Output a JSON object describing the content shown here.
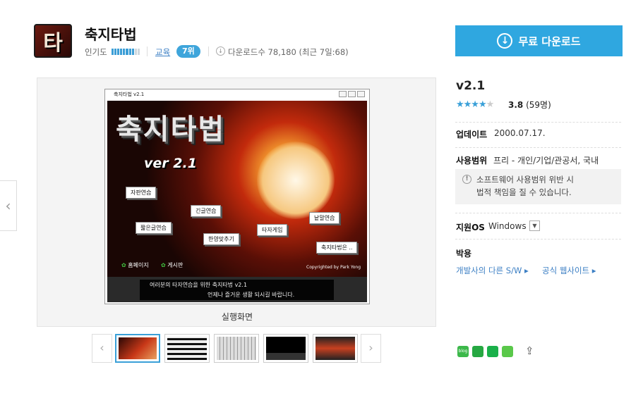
{
  "app": {
    "title": "축지타법",
    "icon_glyph": "타"
  },
  "meta": {
    "popularity_label": "인기도",
    "popularity_level": 0.8,
    "category": "교육",
    "rank": "7위",
    "downloads": "다운로드수 78,180 (최근 7일:68)"
  },
  "download_button": {
    "label": "무료 다운로드"
  },
  "screenshot": {
    "window_title": "축지타법 v2.1",
    "logo": "축지타법",
    "version_text": "ver 2.1",
    "buttons": [
      "자판연습",
      "긴글연습",
      "낱말연습",
      "짧은글연습",
      "타자게임",
      "한영맞추기",
      "축지타법은 .."
    ],
    "footer_left": [
      "홈페이지",
      "게시판"
    ],
    "copyright": "Copyrighted by Park Yong",
    "status_line1": "여러분의 타자연습을 위한 축지타법 v2.1",
    "status_line2": "언제나 즐거운 생활 되시길 바랍니다.",
    "caption": "실행화면"
  },
  "thumbnails": [
    {
      "name": "thumb-1",
      "selected": true
    },
    {
      "name": "thumb-2",
      "selected": false
    },
    {
      "name": "thumb-3",
      "selected": false
    },
    {
      "name": "thumb-4",
      "selected": false
    },
    {
      "name": "thumb-5",
      "selected": false
    }
  ],
  "info": {
    "version": "v2.1",
    "rating": "3.8",
    "rating_count": "(59명)",
    "stars_filled": 4,
    "update_label": "업데이트",
    "update_value": "2000.07.17.",
    "license_label": "사용범위",
    "license_value": "프리 - 개인/기업/관공서, 국내",
    "warning_line1": "소프트웨어 사용범위 위반 시",
    "warning_line2": "법적 책임을 질 수 있습니다.",
    "os_label": "지원OS",
    "os_value": "Windows",
    "developer_name": "박용",
    "link_other": "개발사의 다른 S/W",
    "link_site": "공식 웹사이트"
  },
  "colors": {
    "accent": "#2fa7e0",
    "link": "#3c7fc4"
  }
}
